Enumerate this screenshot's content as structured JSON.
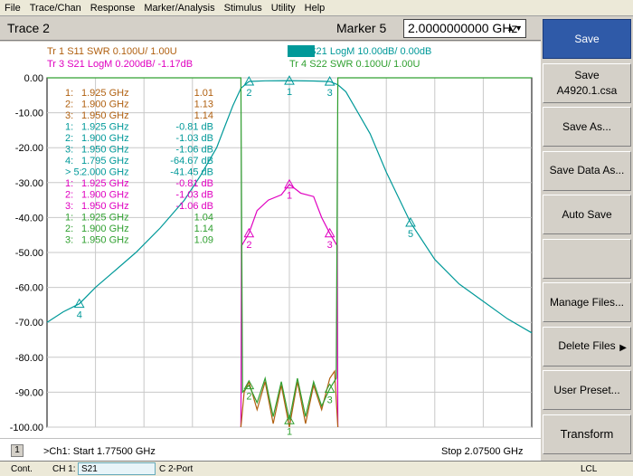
{
  "menu": [
    "File",
    "Trace/Chan",
    "Response",
    "Marker/Analysis",
    "Stimulus",
    "Utility",
    "Help"
  ],
  "title": {
    "trace": "Trace 2",
    "marker_label": "Marker 5",
    "marker_value": "2.0000000000 GHz"
  },
  "traces_header": [
    {
      "label": "Tr  1  S11 SWR 0.100U/  1.00U",
      "color": "#b06010"
    },
    {
      "label": "Tr  2  S21 LogM 10.00dB/  0.00dB",
      "color": "#009999",
      "active": true
    },
    {
      "label": "Tr  3  S21 LogM 0.200dB/  -1.17dB",
      "color": "#e000c0"
    },
    {
      "label": "Tr  4  S22 SWR 0.100U/  1.00U",
      "color": "#30a030"
    }
  ],
  "y_axis": [
    "0.00",
    "-10.00",
    "-20.00",
    "-30.00",
    "-40.00",
    "-50.00",
    "-60.00",
    "-70.00",
    "-80.00",
    "-90.00",
    "-100.00"
  ],
  "marker_table": [
    {
      "n": "1:",
      "f": "1.925 GHz",
      "v": "1.01",
      "color": "#b06010"
    },
    {
      "n": "2:",
      "f": "1.900 GHz",
      "v": "1.13",
      "color": "#b06010"
    },
    {
      "n": "3:",
      "f": "1.950 GHz",
      "v": "1.14",
      "color": "#b06010"
    },
    {
      "n": "1:",
      "f": "1.925 GHz",
      "v": "-0.81 dB",
      "color": "#009999"
    },
    {
      "n": "2:",
      "f": "1.900 GHz",
      "v": "-1.03 dB",
      "color": "#009999"
    },
    {
      "n": "3:",
      "f": "1.950 GHz",
      "v": "-1.06 dB",
      "color": "#009999"
    },
    {
      "n": "4:",
      "f": "1.795 GHz",
      "v": "-64.67 dB",
      "color": "#009999"
    },
    {
      "n": "> 5:",
      "f": "2.000 GHz",
      "v": "-41.45 dB",
      "color": "#009999"
    },
    {
      "n": "1:",
      "f": "1.925 GHz",
      "v": "-0.81 dB",
      "color": "#e000c0"
    },
    {
      "n": "2:",
      "f": "1.900 GHz",
      "v": "-1.03 dB",
      "color": "#e000c0"
    },
    {
      "n": "3:",
      "f": "1.950 GHz",
      "v": "-1.06 dB",
      "color": "#e000c0"
    },
    {
      "n": "1:",
      "f": "1.925 GHz",
      "v": "1.04",
      "color": "#30a030"
    },
    {
      "n": "2:",
      "f": "1.900 GHz",
      "v": "1.14",
      "color": "#30a030"
    },
    {
      "n": "3:",
      "f": "1.950 GHz",
      "v": "1.09",
      "color": "#30a030"
    }
  ],
  "bottom": {
    "channel": "1",
    "start": ">Ch1: Start  1.77500 GHz",
    "stop": "Stop  2.07500 GHz"
  },
  "softkeys": [
    {
      "label": "Save",
      "active": true
    },
    {
      "label": "Save",
      "sub": "A4920.1.csa"
    },
    {
      "label": "Save As..."
    },
    {
      "label": "Save Data As..."
    },
    {
      "label": "Auto Save"
    },
    {
      "label": ""
    },
    {
      "label": "Manage Files..."
    },
    {
      "label": "Delete Files",
      "arrow": "▶"
    },
    {
      "label": "User Preset..."
    },
    {
      "label": "Transform",
      "transform": true
    }
  ],
  "status": {
    "mode": "Cont.",
    "ch": "CH 1:",
    "param": "S21",
    "cal": "C  2-Port",
    "lcl": "LCL"
  },
  "chart_data": {
    "type": "line",
    "x_range_ghz": [
      1.775,
      2.075
    ],
    "ylim": [
      -100,
      0
    ],
    "y_ticks": [
      0,
      -10,
      -20,
      -30,
      -40,
      -50,
      -60,
      -70,
      -80,
      -90,
      -100
    ],
    "series": [
      {
        "name": "S21 LogM",
        "color": "#009999",
        "x": [
          1.775,
          1.785,
          1.795,
          1.805,
          1.815,
          1.83,
          1.845,
          1.86,
          1.87,
          1.88,
          1.885,
          1.89,
          1.895,
          1.9,
          1.91,
          1.925,
          1.94,
          1.95,
          1.955,
          1.96,
          1.965,
          1.975,
          1.985,
          2.0,
          2.015,
          2.03,
          2.045,
          2.06,
          2.075
        ],
        "y": [
          -70,
          -67,
          -64.7,
          -60,
          -56,
          -50,
          -43,
          -35,
          -28,
          -20,
          -14,
          -8,
          -3,
          -1.03,
          -0.85,
          -0.81,
          -0.9,
          -1.06,
          -2,
          -4,
          -8,
          -16,
          -27,
          -41.45,
          -52,
          -59,
          -64,
          -69,
          -73
        ]
      },
      {
        "name": "S21 LogM (0.2 dB/div)",
        "color": "#e000c0",
        "x": [
          1.895,
          1.8955,
          1.9,
          1.905,
          1.912,
          1.92,
          1.925,
          1.932,
          1.94,
          1.945,
          1.95,
          1.9545,
          1.955
        ],
        "y": [
          -100,
          -48,
          -44.5,
          -38,
          -35,
          -33.5,
          -30.5,
          -33,
          -34,
          -40,
          -44.5,
          -48,
          -100
        ]
      },
      {
        "name": "S11 SWR",
        "color": "#b06010",
        "x": [
          1.895,
          1.897,
          1.9,
          1.905,
          1.91,
          1.915,
          1.92,
          1.925,
          1.93,
          1.935,
          1.94,
          1.945,
          1.95,
          1.953,
          1.955
        ],
        "y": [
          -100,
          -90,
          -87,
          -95,
          -87,
          -99,
          -88,
          -100,
          -87,
          -99,
          -88,
          -95,
          -86,
          -84,
          -100
        ]
      },
      {
        "name": "S22 SWR",
        "color": "#30a030",
        "x": [
          1.775,
          1.895,
          1.896,
          1.9,
          1.905,
          1.91,
          1.915,
          1.92,
          1.925,
          1.93,
          1.935,
          1.94,
          1.945,
          1.95,
          1.954,
          1.955,
          2.075
        ],
        "y": [
          0,
          0,
          -90,
          -88,
          -93,
          -86,
          -97,
          -87,
          -98,
          -86,
          -97,
          -87,
          -94,
          -89,
          -86,
          0,
          0
        ]
      }
    ],
    "markers": [
      {
        "label": "1",
        "x": 1.925,
        "y": -0.81,
        "color": "#009999"
      },
      {
        "label": "2",
        "x": 1.9,
        "y": -1.03,
        "color": "#009999"
      },
      {
        "label": "3",
        "x": 1.95,
        "y": -1.06,
        "color": "#009999"
      },
      {
        "label": "4",
        "x": 1.795,
        "y": -64.67,
        "color": "#009999"
      },
      {
        "label": "5",
        "x": 2.0,
        "y": -41.45,
        "color": "#009999"
      },
      {
        "label": "1",
        "x": 1.925,
        "y": -30.5,
        "color": "#e000c0"
      },
      {
        "label": "2",
        "x": 1.9,
        "y": -44.5,
        "color": "#e000c0"
      },
      {
        "label": "3",
        "x": 1.95,
        "y": -44.5,
        "color": "#e000c0"
      },
      {
        "label": "1",
        "x": 1.925,
        "y": -98,
        "color": "#30a030"
      },
      {
        "label": "2",
        "x": 1.9,
        "y": -88,
        "color": "#30a030"
      },
      {
        "label": "3",
        "x": 1.95,
        "y": -89,
        "color": "#30a030"
      }
    ]
  }
}
